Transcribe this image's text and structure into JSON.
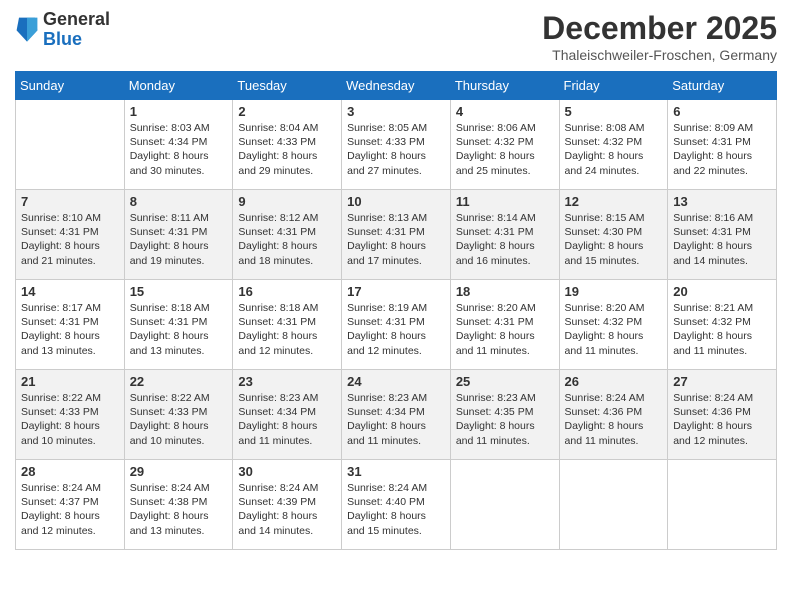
{
  "logo": {
    "general": "General",
    "blue": "Blue"
  },
  "title": "December 2025",
  "location": "Thaleischweiler-Froschen, Germany",
  "days_of_week": [
    "Sunday",
    "Monday",
    "Tuesday",
    "Wednesday",
    "Thursday",
    "Friday",
    "Saturday"
  ],
  "weeks": [
    [
      {
        "day": "",
        "sunrise": "",
        "sunset": "",
        "daylight": ""
      },
      {
        "day": "1",
        "sunrise": "Sunrise: 8:03 AM",
        "sunset": "Sunset: 4:34 PM",
        "daylight": "Daylight: 8 hours and 30 minutes."
      },
      {
        "day": "2",
        "sunrise": "Sunrise: 8:04 AM",
        "sunset": "Sunset: 4:33 PM",
        "daylight": "Daylight: 8 hours and 29 minutes."
      },
      {
        "day": "3",
        "sunrise": "Sunrise: 8:05 AM",
        "sunset": "Sunset: 4:33 PM",
        "daylight": "Daylight: 8 hours and 27 minutes."
      },
      {
        "day": "4",
        "sunrise": "Sunrise: 8:06 AM",
        "sunset": "Sunset: 4:32 PM",
        "daylight": "Daylight: 8 hours and 25 minutes."
      },
      {
        "day": "5",
        "sunrise": "Sunrise: 8:08 AM",
        "sunset": "Sunset: 4:32 PM",
        "daylight": "Daylight: 8 hours and 24 minutes."
      },
      {
        "day": "6",
        "sunrise": "Sunrise: 8:09 AM",
        "sunset": "Sunset: 4:31 PM",
        "daylight": "Daylight: 8 hours and 22 minutes."
      }
    ],
    [
      {
        "day": "7",
        "sunrise": "Sunrise: 8:10 AM",
        "sunset": "Sunset: 4:31 PM",
        "daylight": "Daylight: 8 hours and 21 minutes."
      },
      {
        "day": "8",
        "sunrise": "Sunrise: 8:11 AM",
        "sunset": "Sunset: 4:31 PM",
        "daylight": "Daylight: 8 hours and 19 minutes."
      },
      {
        "day": "9",
        "sunrise": "Sunrise: 8:12 AM",
        "sunset": "Sunset: 4:31 PM",
        "daylight": "Daylight: 8 hours and 18 minutes."
      },
      {
        "day": "10",
        "sunrise": "Sunrise: 8:13 AM",
        "sunset": "Sunset: 4:31 PM",
        "daylight": "Daylight: 8 hours and 17 minutes."
      },
      {
        "day": "11",
        "sunrise": "Sunrise: 8:14 AM",
        "sunset": "Sunset: 4:31 PM",
        "daylight": "Daylight: 8 hours and 16 minutes."
      },
      {
        "day": "12",
        "sunrise": "Sunrise: 8:15 AM",
        "sunset": "Sunset: 4:30 PM",
        "daylight": "Daylight: 8 hours and 15 minutes."
      },
      {
        "day": "13",
        "sunrise": "Sunrise: 8:16 AM",
        "sunset": "Sunset: 4:31 PM",
        "daylight": "Daylight: 8 hours and 14 minutes."
      }
    ],
    [
      {
        "day": "14",
        "sunrise": "Sunrise: 8:17 AM",
        "sunset": "Sunset: 4:31 PM",
        "daylight": "Daylight: 8 hours and 13 minutes."
      },
      {
        "day": "15",
        "sunrise": "Sunrise: 8:18 AM",
        "sunset": "Sunset: 4:31 PM",
        "daylight": "Daylight: 8 hours and 13 minutes."
      },
      {
        "day": "16",
        "sunrise": "Sunrise: 8:18 AM",
        "sunset": "Sunset: 4:31 PM",
        "daylight": "Daylight: 8 hours and 12 minutes."
      },
      {
        "day": "17",
        "sunrise": "Sunrise: 8:19 AM",
        "sunset": "Sunset: 4:31 PM",
        "daylight": "Daylight: 8 hours and 12 minutes."
      },
      {
        "day": "18",
        "sunrise": "Sunrise: 8:20 AM",
        "sunset": "Sunset: 4:31 PM",
        "daylight": "Daylight: 8 hours and 11 minutes."
      },
      {
        "day": "19",
        "sunrise": "Sunrise: 8:20 AM",
        "sunset": "Sunset: 4:32 PM",
        "daylight": "Daylight: 8 hours and 11 minutes."
      },
      {
        "day": "20",
        "sunrise": "Sunrise: 8:21 AM",
        "sunset": "Sunset: 4:32 PM",
        "daylight": "Daylight: 8 hours and 11 minutes."
      }
    ],
    [
      {
        "day": "21",
        "sunrise": "Sunrise: 8:22 AM",
        "sunset": "Sunset: 4:33 PM",
        "daylight": "Daylight: 8 hours and 10 minutes."
      },
      {
        "day": "22",
        "sunrise": "Sunrise: 8:22 AM",
        "sunset": "Sunset: 4:33 PM",
        "daylight": "Daylight: 8 hours and 10 minutes."
      },
      {
        "day": "23",
        "sunrise": "Sunrise: 8:23 AM",
        "sunset": "Sunset: 4:34 PM",
        "daylight": "Daylight: 8 hours and 11 minutes."
      },
      {
        "day": "24",
        "sunrise": "Sunrise: 8:23 AM",
        "sunset": "Sunset: 4:34 PM",
        "daylight": "Daylight: 8 hours and 11 minutes."
      },
      {
        "day": "25",
        "sunrise": "Sunrise: 8:23 AM",
        "sunset": "Sunset: 4:35 PM",
        "daylight": "Daylight: 8 hours and 11 minutes."
      },
      {
        "day": "26",
        "sunrise": "Sunrise: 8:24 AM",
        "sunset": "Sunset: 4:36 PM",
        "daylight": "Daylight: 8 hours and 11 minutes."
      },
      {
        "day": "27",
        "sunrise": "Sunrise: 8:24 AM",
        "sunset": "Sunset: 4:36 PM",
        "daylight": "Daylight: 8 hours and 12 minutes."
      }
    ],
    [
      {
        "day": "28",
        "sunrise": "Sunrise: 8:24 AM",
        "sunset": "Sunset: 4:37 PM",
        "daylight": "Daylight: 8 hours and 12 minutes."
      },
      {
        "day": "29",
        "sunrise": "Sunrise: 8:24 AM",
        "sunset": "Sunset: 4:38 PM",
        "daylight": "Daylight: 8 hours and 13 minutes."
      },
      {
        "day": "30",
        "sunrise": "Sunrise: 8:24 AM",
        "sunset": "Sunset: 4:39 PM",
        "daylight": "Daylight: 8 hours and 14 minutes."
      },
      {
        "day": "31",
        "sunrise": "Sunrise: 8:24 AM",
        "sunset": "Sunset: 4:40 PM",
        "daylight": "Daylight: 8 hours and 15 minutes."
      },
      {
        "day": "",
        "sunrise": "",
        "sunset": "",
        "daylight": ""
      },
      {
        "day": "",
        "sunrise": "",
        "sunset": "",
        "daylight": ""
      },
      {
        "day": "",
        "sunrise": "",
        "sunset": "",
        "daylight": ""
      }
    ]
  ]
}
